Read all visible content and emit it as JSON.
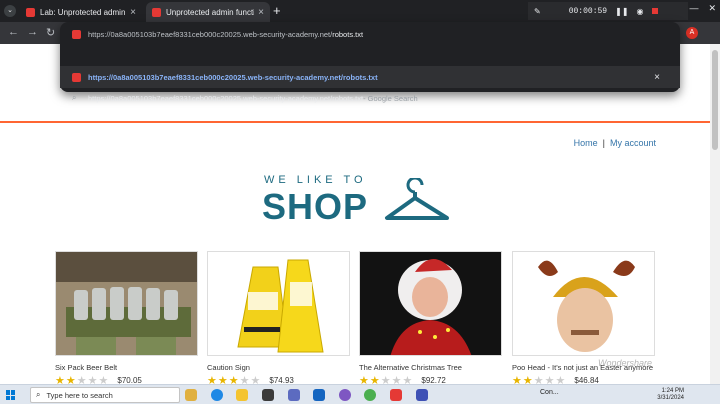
{
  "browser": {
    "tabs": [
      {
        "title": "Lab: Unprotected admin functionality",
        "close": "×"
      },
      {
        "title": "Unprotected admin functionality",
        "close": "×"
      }
    ],
    "new_tab": "+",
    "recorder_time": "00:00:59",
    "avatar_letter": "A",
    "omnibox": {
      "scheme": "https://",
      "host_path": "0a8a005103b7eaef8331ceb000c20025.web-security-academy.net/",
      "typed": "robots.txt",
      "suggestions": [
        {
          "text": "https://0a8a005103b7eaef8331ceb000c20025.web-security-academy.net/robots.txt",
          "close": "×"
        },
        {
          "text": "https://0a8a005103b7eaef8331ceb000c20025.web-security-academy.net/robots.txt",
          "suffix": " - Google Search"
        }
      ]
    }
  },
  "site": {
    "nav": {
      "home": "Home",
      "sep": "|",
      "account": "My account"
    },
    "hero": {
      "small": "WE LIKE TO",
      "big": "SHOP"
    },
    "products": [
      {
        "name": "Six Pack Beer Belt",
        "stars": 2,
        "price": "$70.05"
      },
      {
        "name": "Caution Sign",
        "stars": 3,
        "price": "$74.93"
      },
      {
        "name": "The Alternative Christmas Tree",
        "stars": 2,
        "price": "$92.72"
      },
      {
        "name": "Poo Head - It's not just an Easter anymore",
        "stars": 2,
        "price": "$46.84"
      }
    ]
  },
  "watermark": "Wondershare",
  "taskbar": {
    "search_placeholder": "Type here to search",
    "connection": "Con...",
    "time": "1:24 PM",
    "date": "3/31/2024"
  }
}
